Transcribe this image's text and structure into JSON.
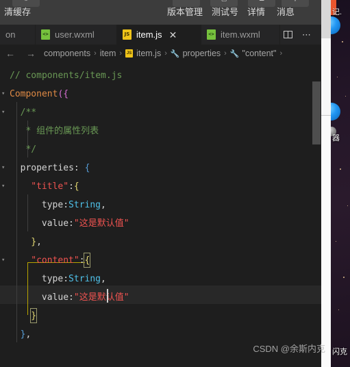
{
  "toolbar": {
    "left_label": "清缓存",
    "buttons": [
      {
        "label": "版本管理",
        "icon": "branch-icon"
      },
      {
        "label": "测试号",
        "icon": "phone-icon"
      },
      {
        "label": "详情",
        "icon": "info-icon"
      },
      {
        "label": "消息",
        "icon": "message-icon"
      }
    ]
  },
  "tabs": {
    "items": [
      {
        "label": "on",
        "icon": "json-file-icon",
        "active": false,
        "partial": true
      },
      {
        "label": "user.wxml",
        "icon": "wxml-file-icon",
        "active": false
      },
      {
        "label": "item.js",
        "icon": "js-file-icon",
        "active": true
      },
      {
        "label": "item.wxml",
        "icon": "wxml-file-icon",
        "active": false
      }
    ],
    "close_label": "✕",
    "split_editor_label": "split-editor-icon",
    "more_label": "⋯"
  },
  "breadcrumb": {
    "back_label": "←",
    "forward_label": "→",
    "items": [
      {
        "label": "components",
        "icon": null
      },
      {
        "label": "item",
        "icon": null
      },
      {
        "label": "item.js",
        "icon": "js-file-icon"
      },
      {
        "label": "properties",
        "icon": "symbol-property-icon"
      },
      {
        "label": "\"content\"",
        "icon": "symbol-property-icon"
      }
    ],
    "separator": "›"
  },
  "code": {
    "lines": [
      {
        "indent": 0,
        "tokens": [
          {
            "t": "// components/item.js",
            "c": "t-comment"
          }
        ]
      },
      {
        "indent": 0,
        "tokens": [
          {
            "t": "Component",
            "c": "t-fn"
          },
          {
            "t": "(",
            "c": "t-paren"
          },
          {
            "t": "{",
            "c": "t-brace-p"
          }
        ]
      },
      {
        "indent": 1,
        "tokens": [
          {
            "t": "/**",
            "c": "t-comment"
          }
        ]
      },
      {
        "indent": 1,
        "tokens": [
          {
            "t": " * 组件的属性列表",
            "c": "t-comment"
          }
        ]
      },
      {
        "indent": 1,
        "tokens": [
          {
            "t": " */",
            "c": "t-comment"
          }
        ]
      },
      {
        "indent": 1,
        "tokens": [
          {
            "t": "properties",
            "c": "t-prop"
          },
          {
            "t": ": ",
            "c": "t-punct"
          },
          {
            "t": "{",
            "c": "t-brace-b"
          }
        ]
      },
      {
        "indent": 2,
        "tokens": [
          {
            "t": "\"title\"",
            "c": "t-key"
          },
          {
            "t": ":",
            "c": "t-punct"
          },
          {
            "t": "{",
            "c": "t-brace-y"
          }
        ]
      },
      {
        "indent": 3,
        "tokens": [
          {
            "t": "type",
            "c": "t-plain"
          },
          {
            "t": ":",
            "c": "t-punct"
          },
          {
            "t": "String",
            "c": "t-type"
          },
          {
            "t": ",",
            "c": "t-punct"
          }
        ]
      },
      {
        "indent": 3,
        "tokens": [
          {
            "t": "value",
            "c": "t-plain"
          },
          {
            "t": ":",
            "c": "t-punct"
          },
          {
            "t": "\"这是默认值\"",
            "c": "t-str"
          }
        ]
      },
      {
        "indent": 2,
        "tokens": [
          {
            "t": "}",
            "c": "t-brace-y"
          },
          {
            "t": ",",
            "c": "t-punct"
          }
        ]
      },
      {
        "indent": 2,
        "tokens": [
          {
            "t": "\"content\"",
            "c": "t-key"
          },
          {
            "t": ":",
            "c": "t-punct"
          },
          {
            "t": "{",
            "c": "t-brace-y"
          }
        ]
      },
      {
        "indent": 3,
        "tokens": [
          {
            "t": "type",
            "c": "t-plain"
          },
          {
            "t": ":",
            "c": "t-punct"
          },
          {
            "t": "String",
            "c": "t-type"
          },
          {
            "t": ",",
            "c": "t-punct"
          }
        ]
      },
      {
        "indent": 3,
        "tokens": [
          {
            "t": "value",
            "c": "t-plain"
          },
          {
            "t": ":",
            "c": "t-punct"
          },
          {
            "t": "\"这是默认值\"",
            "c": "t-str"
          }
        ]
      },
      {
        "indent": 2,
        "tokens": [
          {
            "t": "}",
            "c": "t-brace-y"
          }
        ]
      },
      {
        "indent": 1,
        "tokens": [
          {
            "t": "}",
            "c": "t-brace-b"
          },
          {
            "t": ",",
            "c": "t-punct"
          }
        ]
      }
    ],
    "active_line_index": 12,
    "fold_rows": [
      1,
      2,
      5,
      6,
      10
    ]
  },
  "desktop": {
    "label_1": "记.",
    "label_2": "器",
    "label_3": "闪克"
  },
  "watermark": {
    "text": "CSDN @余斯内克"
  },
  "colors": {
    "editor_bg": "#1e1e1e",
    "toolbar_bg": "#3c3c3c",
    "tabbar_bg": "#252526",
    "accent_js": "#f0c419",
    "accent_wxml": "#76c13d",
    "comment": "#6a9955",
    "string": "#ef5350",
    "type": "#4fc1e9"
  }
}
